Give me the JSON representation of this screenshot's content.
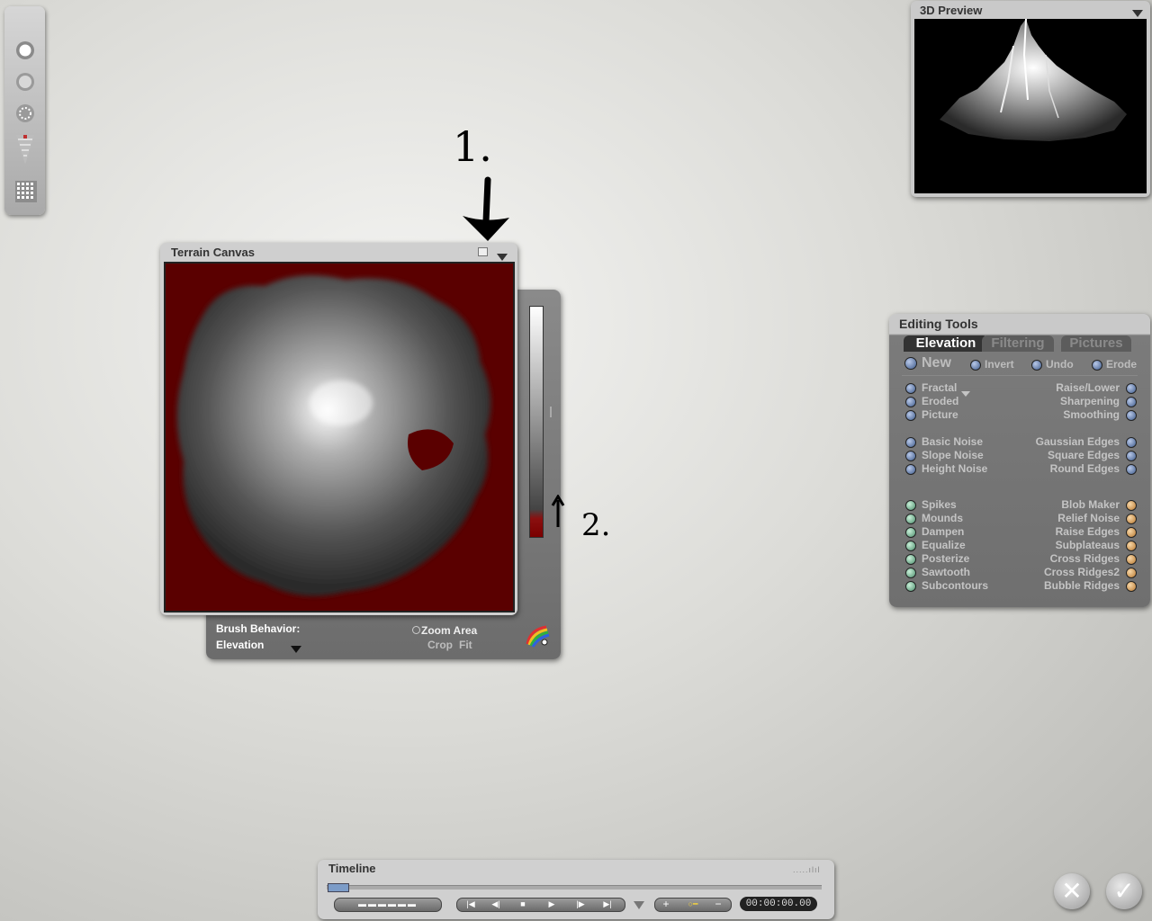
{
  "preview": {
    "title": "3D Preview"
  },
  "terrain_canvas": {
    "title": "Terrain Canvas",
    "brush_behavior_label": "Brush Behavior:",
    "brush_behavior_value": "Elevation",
    "zoom_area": "Zoom Area",
    "crop": "Crop",
    "fit": "Fit"
  },
  "annotations": {
    "mark_1": "1.",
    "mark_2": "2."
  },
  "editing_tools": {
    "title": "Editing Tools",
    "tabs": [
      "Elevation",
      "Filtering",
      "Pictures"
    ],
    "actions": {
      "new": "New",
      "invert": "Invert",
      "undo": "Undo",
      "erode": "Erode"
    },
    "group1_left": [
      "Fractal",
      "Eroded",
      "Picture"
    ],
    "group1_right": [
      "Raise/Lower",
      "Sharpening",
      "Smoothing"
    ],
    "group2_left": [
      "Basic Noise",
      "Slope Noise",
      "Height Noise"
    ],
    "group2_right": [
      "Gaussian Edges",
      "Square Edges",
      "Round Edges"
    ],
    "group3_left": [
      "Spikes",
      "Mounds",
      "Dampen",
      "Equalize",
      "Posterize",
      "Sawtooth",
      "Subcontours"
    ],
    "group3_right": [
      "Blob Maker",
      "Relief Noise",
      "Raise Edges",
      "Subplateaus",
      "Cross Ridges",
      "Cross Ridges2",
      "Bubble Ridges"
    ]
  },
  "timeline": {
    "title": "Timeline",
    "time": "00:00:00.00"
  },
  "colors": {
    "canvas_bg": "#5a0000",
    "blue_dot": "#3d5a8a",
    "green_dot": "#4c8c6c",
    "orange_dot": "#b87830"
  }
}
